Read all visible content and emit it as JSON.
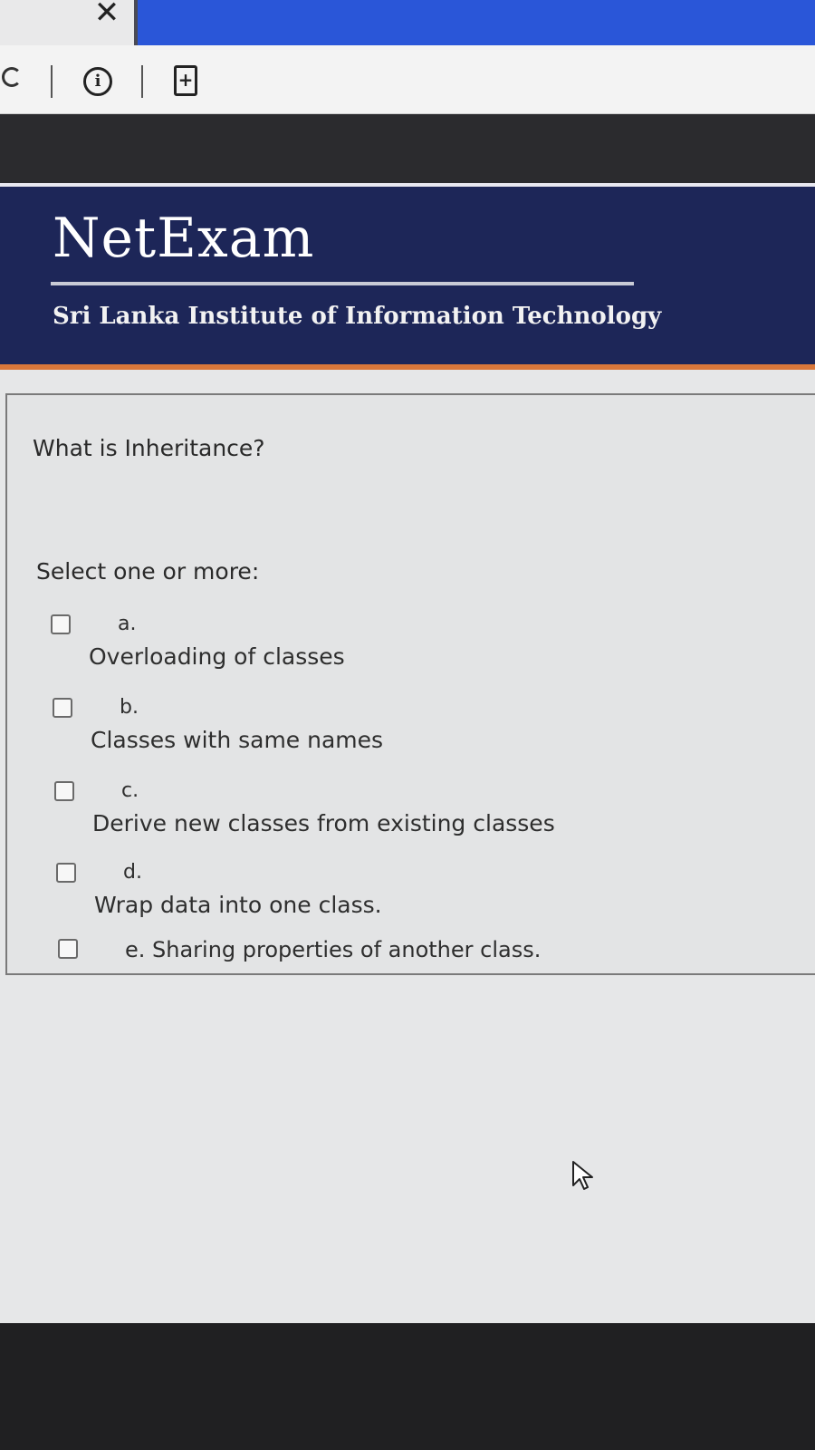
{
  "browser": {
    "close_glyph": "✕",
    "info_glyph": "i",
    "add_page_glyph": "+"
  },
  "header": {
    "logo": "NetExam",
    "institute": "Sri Lanka Institute of Information Technology"
  },
  "question": {
    "text": "What is Inheritance?",
    "prompt": "Select one or more:",
    "options": [
      {
        "letter": "a.",
        "text": "Overloading of classes",
        "checked": false
      },
      {
        "letter": "b.",
        "text": "Classes with same names",
        "checked": false
      },
      {
        "letter": "c.",
        "text": "Derive new classes from existing classes",
        "checked": false
      },
      {
        "letter": "d.",
        "text": "Wrap data into one class.",
        "checked": false
      },
      {
        "letter": "",
        "text": "e. Sharing properties of another class.",
        "checked": false
      }
    ]
  },
  "colors": {
    "banner": "#1d2658",
    "accent_orange": "#d9773a",
    "tab_active": "#2a56d8"
  },
  "icons": [
    "close-icon",
    "reload-icon",
    "info-icon",
    "add-page-icon",
    "checkbox-icon",
    "mouse-pointer-icon"
  ]
}
